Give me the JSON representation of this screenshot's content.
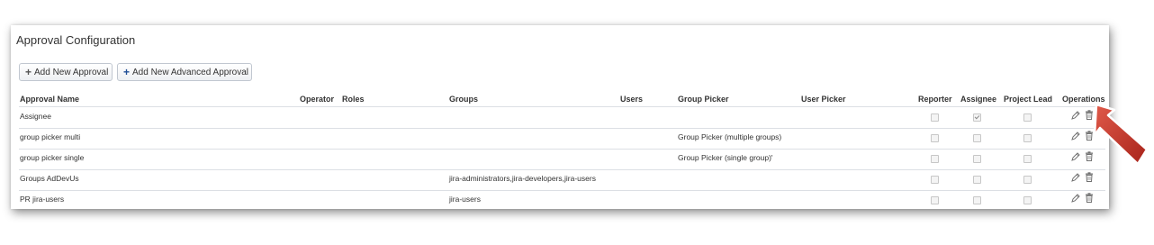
{
  "page": {
    "title": "Approval Configuration"
  },
  "toolbar": {
    "add_approval_label": "Add New Approval",
    "add_advanced_label": "Add New Advanced Approval"
  },
  "table": {
    "headers": {
      "approval_name": "Approval Name",
      "operator": "Operator",
      "roles": "Roles",
      "groups": "Groups",
      "users": "Users",
      "group_picker": "Group Picker",
      "user_picker": "User Picker",
      "reporter": "Reporter",
      "assignee": "Assignee",
      "project_lead": "Project Lead",
      "operations": "Operations"
    },
    "rows": [
      {
        "name": "Assignee",
        "groups": "",
        "group_picker": "",
        "reporter": false,
        "assignee": true,
        "project_lead": false
      },
      {
        "name": "group picker multi",
        "groups": "",
        "group_picker": "Group Picker (multiple groups)",
        "reporter": false,
        "assignee": false,
        "project_lead": false
      },
      {
        "name": "group picker single",
        "groups": "",
        "group_picker": "Group Picker (single group)'",
        "reporter": false,
        "assignee": false,
        "project_lead": false
      },
      {
        "name": "Groups AdDevUs",
        "groups": "jira-administrators,jira-developers,jira-users",
        "group_picker": "",
        "reporter": false,
        "assignee": false,
        "project_lead": false
      },
      {
        "name": "PR jira-users",
        "groups": "jira-users",
        "group_picker": "",
        "reporter": false,
        "assignee": false,
        "project_lead": false
      }
    ]
  },
  "icons": {
    "edit": "pencil-icon",
    "delete": "trash-icon",
    "add": "plus-icon",
    "pointer": "red-arrow-icon"
  },
  "colors": {
    "accent_blue": "#1f4e96",
    "arrow_red": "#c0392b"
  }
}
